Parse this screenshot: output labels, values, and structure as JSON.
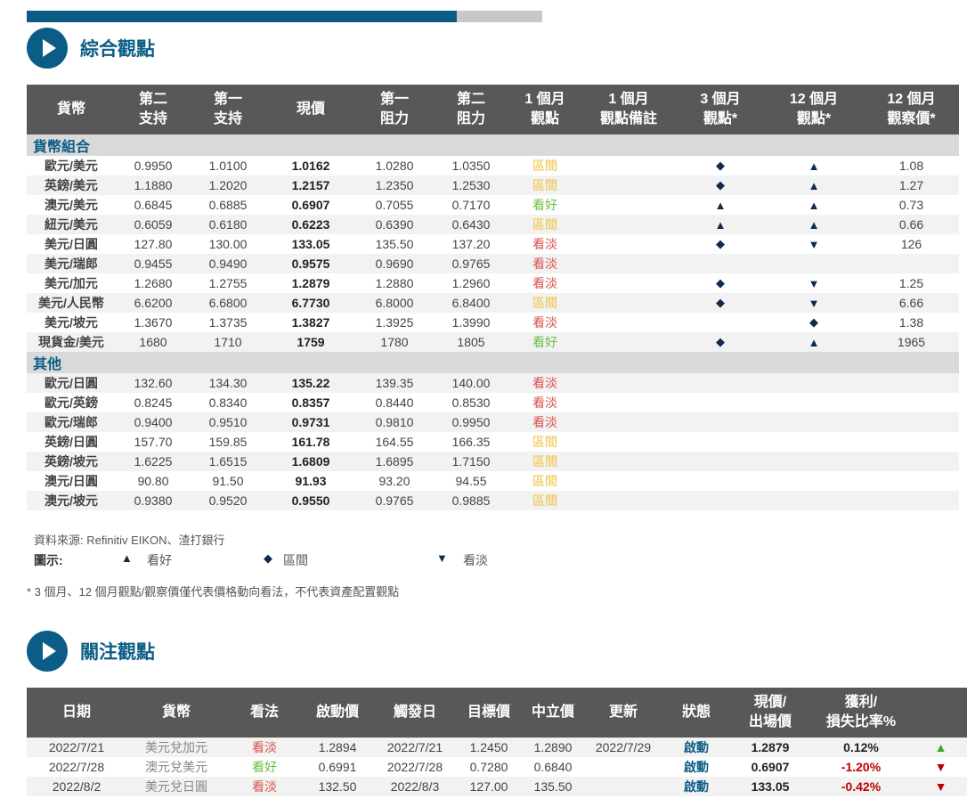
{
  "progress": {
    "fraction": 0.834,
    "fill_color": "#0b5d86",
    "track_color": "#c8c8c8"
  },
  "section1": {
    "title": "綜合觀點",
    "icon": "play-icon"
  },
  "fx_table": {
    "headers": [
      [
        "貨幣"
      ],
      [
        "第二",
        "支持"
      ],
      [
        "第一",
        "支持"
      ],
      [
        "現價"
      ],
      [
        "第一",
        "阻力"
      ],
      [
        "第二",
        "阻力"
      ],
      [
        "1 個月",
        "觀點"
      ],
      [
        "1 個月",
        "觀點備註"
      ],
      [
        "3 個月",
        "觀點*"
      ],
      [
        "12 個月",
        "觀點*"
      ],
      [
        "12 個月",
        "觀察價*"
      ]
    ],
    "groups": [
      {
        "name": "貨幣組合",
        "rows": [
          {
            "pair": "歐元/美元",
            "s2": "0.9950",
            "s1": "1.0100",
            "spot": "1.0162",
            "r1": "1.0280",
            "r2": "1.0350",
            "view1m": "區間",
            "view1m_class": "range",
            "note": "",
            "view3m": "◆",
            "view12m": "▲",
            "price12m": "1.08"
          },
          {
            "pair": "英鎊/美元",
            "s2": "1.1880",
            "s1": "1.2020",
            "spot": "1.2157",
            "r1": "1.2350",
            "r2": "1.2530",
            "view1m": "區間",
            "view1m_class": "range",
            "note": "",
            "view3m": "◆",
            "view12m": "▲",
            "price12m": "1.27"
          },
          {
            "pair": "澳元/美元",
            "s2": "0.6845",
            "s1": "0.6885",
            "spot": "0.6907",
            "r1": "0.7055",
            "r2": "0.7170",
            "view1m": "看好",
            "view1m_class": "bull",
            "note": "",
            "view3m": "▲",
            "view12m": "▲",
            "price12m": "0.73"
          },
          {
            "pair": "紐元/美元",
            "s2": "0.6059",
            "s1": "0.6180",
            "spot": "0.6223",
            "r1": "0.6390",
            "r2": "0.6430",
            "view1m": "區間",
            "view1m_class": "range",
            "note": "",
            "view3m": "▲",
            "view12m": "▲",
            "price12m": "0.66"
          },
          {
            "pair": "美元/日圓",
            "s2": "127.80",
            "s1": "130.00",
            "spot": "133.05",
            "r1": "135.50",
            "r2": "137.20",
            "view1m": "看淡",
            "view1m_class": "bear",
            "note": "",
            "view3m": "◆",
            "view12m": "▼",
            "price12m": "126"
          },
          {
            "pair": "美元/瑞郎",
            "s2": "0.9455",
            "s1": "0.9490",
            "spot": "0.9575",
            "r1": "0.9690",
            "r2": "0.9765",
            "view1m": "看淡",
            "view1m_class": "bear",
            "note": "",
            "view3m": "",
            "view12m": "",
            "price12m": ""
          },
          {
            "pair": "美元/加元",
            "s2": "1.2680",
            "s1": "1.2755",
            "spot": "1.2879",
            "r1": "1.2880",
            "r2": "1.2960",
            "view1m": "看淡",
            "view1m_class": "bear",
            "note": "",
            "view3m": "◆",
            "view12m": "▼",
            "price12m": "1.25"
          },
          {
            "pair": "美元/人民幣",
            "s2": "6.6200",
            "s1": "6.6800",
            "spot": "6.7730",
            "r1": "6.8000",
            "r2": "6.8400",
            "view1m": "區間",
            "view1m_class": "range",
            "note": "",
            "view3m": "◆",
            "view12m": "▼",
            "price12m": "6.66"
          },
          {
            "pair": "美元/坡元",
            "s2": "1.3670",
            "s1": "1.3735",
            "spot": "1.3827",
            "r1": "1.3925",
            "r2": "1.3990",
            "view1m": "看淡",
            "view1m_class": "bear",
            "note": "",
            "view3m": "",
            "view12m": "◆",
            "price12m": "1.38"
          },
          {
            "pair": "現貨金/美元",
            "s2": "1680",
            "s1": "1710",
            "spot": "1759",
            "r1": "1780",
            "r2": "1805",
            "view1m": "看好",
            "view1m_class": "bull",
            "note": "",
            "view3m": "◆",
            "view12m": "▲",
            "price12m": "1965"
          }
        ]
      },
      {
        "name": "其他",
        "rows": [
          {
            "pair": "歐元/日圓",
            "s2": "132.60",
            "s1": "134.30",
            "spot": "135.22",
            "r1": "139.35",
            "r2": "140.00",
            "view1m": "看淡",
            "view1m_class": "bear",
            "note": "",
            "view3m": "",
            "view12m": "",
            "price12m": ""
          },
          {
            "pair": "歐元/英鎊",
            "s2": "0.8245",
            "s1": "0.8340",
            "spot": "0.8357",
            "r1": "0.8440",
            "r2": "0.8530",
            "view1m": "看淡",
            "view1m_class": "bear",
            "note": "",
            "view3m": "",
            "view12m": "",
            "price12m": ""
          },
          {
            "pair": "歐元/瑞郎",
            "s2": "0.9400",
            "s1": "0.9510",
            "spot": "0.9731",
            "r1": "0.9810",
            "r2": "0.9950",
            "view1m": "看淡",
            "view1m_class": "bear",
            "note": "",
            "view3m": "",
            "view12m": "",
            "price12m": ""
          },
          {
            "pair": "英鎊/日圓",
            "s2": "157.70",
            "s1": "159.85",
            "spot": "161.78",
            "r1": "164.55",
            "r2": "166.35",
            "view1m": "區間",
            "view1m_class": "range",
            "note": "",
            "view3m": "",
            "view12m": "",
            "price12m": ""
          },
          {
            "pair": "英鎊/坡元",
            "s2": "1.6225",
            "s1": "1.6515",
            "spot": "1.6809",
            "r1": "1.6895",
            "r2": "1.7150",
            "view1m": "區間",
            "view1m_class": "range",
            "note": "",
            "view3m": "",
            "view12m": "",
            "price12m": ""
          },
          {
            "pair": "澳元/日圓",
            "s2": "90.80",
            "s1": "91.50",
            "spot": "91.93",
            "r1": "93.20",
            "r2": "94.55",
            "view1m": "區間",
            "view1m_class": "range",
            "note": "",
            "view3m": "",
            "view12m": "",
            "price12m": ""
          },
          {
            "pair": "澳元/坡元",
            "s2": "0.9380",
            "s1": "0.9520",
            "spot": "0.9550",
            "r1": "0.9765",
            "r2": "0.9885",
            "view1m": "區間",
            "view1m_class": "range",
            "note": "",
            "view3m": "",
            "view12m": "",
            "price12m": ""
          }
        ]
      }
    ]
  },
  "source_note": "資料來源: Refinitiv EIKON、渣打銀行",
  "legend": {
    "label": "圖示:",
    "items": [
      {
        "symbol": "▲",
        "text": "看好"
      },
      {
        "symbol": "◆",
        "text": "區間"
      },
      {
        "symbol": "▼",
        "text": "看淡"
      }
    ]
  },
  "footnote": "* 3 個月、12 個月觀點/觀察價僅代表價格動向看法，不代表資產配置觀點",
  "section2": {
    "title": "關注觀點",
    "icon": "play-icon"
  },
  "focus_table": {
    "headers": [
      [
        "日期"
      ],
      [
        "貨幣"
      ],
      [
        "看法"
      ],
      [
        "啟動價"
      ],
      [
        "觸發日"
      ],
      [
        "目標價"
      ],
      [
        "中立價"
      ],
      [
        "更新"
      ],
      [
        "狀態"
      ],
      [
        "現價/",
        "出場價"
      ],
      [
        "獲利/",
        "損失比率%"
      ],
      [
        ""
      ]
    ],
    "rows": [
      {
        "date": "2022/7/21",
        "currency": "美元兌加元",
        "view": "看淡",
        "view_class": "bear",
        "entry": "1.2894",
        "trigger": "2022/7/21",
        "target": "1.2450",
        "neutral": "1.2890",
        "update": "2022/7/29",
        "status": "啟動",
        "price": "1.2879",
        "pl": "0.12%",
        "pl_class": "pos",
        "arrow": "▲",
        "arrow_class": "arr-up"
      },
      {
        "date": "2022/7/28",
        "currency": "澳元兌美元",
        "view": "看好",
        "view_class": "bull",
        "entry": "0.6991",
        "trigger": "2022/7/28",
        "target": "0.7280",
        "neutral": "0.6840",
        "update": "",
        "status": "啟動",
        "price": "0.6907",
        "pl": "-1.20%",
        "pl_class": "neg",
        "arrow": "▼",
        "arrow_class": "arr-dn"
      },
      {
        "date": "2022/8/2",
        "currency": "美元兌日圓",
        "view": "看淡",
        "view_class": "bear",
        "entry": "132.50",
        "trigger": "2022/8/3",
        "target": "127.00",
        "neutral": "135.50",
        "update": "",
        "status": "啟動",
        "price": "133.05",
        "pl": "-0.42%",
        "pl_class": "neg",
        "arrow": "▼",
        "arrow_class": "arr-dn"
      }
    ]
  }
}
